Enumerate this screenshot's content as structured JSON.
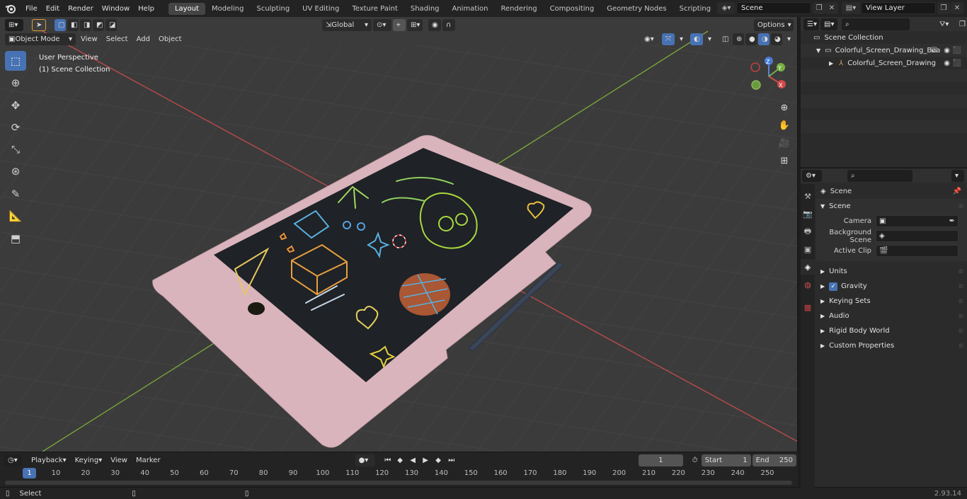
{
  "menubar": {
    "items": [
      "File",
      "Edit",
      "Render",
      "Window",
      "Help"
    ],
    "workspaces": [
      "Layout",
      "Modeling",
      "Sculpting",
      "UV Editing",
      "Texture Paint",
      "Shading",
      "Animation",
      "Rendering",
      "Compositing",
      "Geometry Nodes",
      "Scripting"
    ],
    "active_workspace": "Layout",
    "scene": "Scene",
    "view_layer": "View Layer"
  },
  "viewport": {
    "mode": "Object Mode",
    "menus": [
      "View",
      "Select",
      "Add",
      "Object"
    ],
    "transform_orientation": "Global",
    "options_label": "Options",
    "perspective_label": "User Perspective",
    "collection_label": "(1) Scene Collection",
    "gizmo": {
      "x": "X",
      "y": "Y",
      "z": "Z"
    }
  },
  "outliner": {
    "root": "Scene Collection",
    "items": [
      {
        "label": "Colorful_Screen_Drawing_Boa"
      },
      {
        "label": "Colorful_Screen_Drawing"
      }
    ]
  },
  "properties": {
    "context": "Scene",
    "section_title": "Scene",
    "fields": [
      {
        "label": "Camera",
        "value": ""
      },
      {
        "label": "Background Scene",
        "value": ""
      },
      {
        "label": "Active Clip",
        "value": ""
      }
    ],
    "panels": [
      "Units",
      "Gravity",
      "Keying Sets",
      "Audio",
      "Rigid Body World",
      "Custom Properties"
    ],
    "gravity_checked": true
  },
  "timeline": {
    "menus": [
      "Playback",
      "Keying",
      "View",
      "Marker"
    ],
    "current_frame": "1",
    "start_label": "Start",
    "start": "1",
    "end_label": "End",
    "end": "250",
    "ticks": [
      "1",
      "10",
      "20",
      "30",
      "40",
      "50",
      "60",
      "70",
      "80",
      "90",
      "100",
      "110",
      "120",
      "130",
      "140",
      "150",
      "160",
      "170",
      "180",
      "190",
      "200",
      "210",
      "220",
      "230",
      "240",
      "250"
    ]
  },
  "statusbar": {
    "left": "Select",
    "version": "2.93.14"
  },
  "colors": {
    "accent": "#4772b3",
    "tablet": "#d9b4bc",
    "screen": "#1f2226",
    "axis_x": "#b94a4a",
    "axis_y": "#7aa33a"
  }
}
